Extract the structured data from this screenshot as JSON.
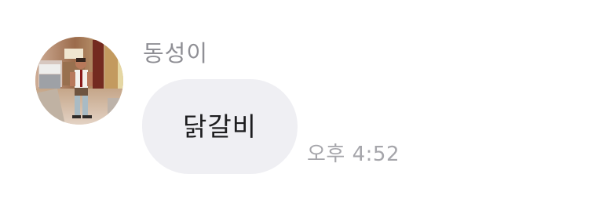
{
  "message": {
    "sender_name": "동성이",
    "avatar_icon": "profile-photo-avatar",
    "text": "닭갈비",
    "timestamp": "오후 4:52"
  },
  "colors": {
    "background": "#ffffff",
    "bubble": "#efeff3",
    "sender_name": "#8f8f95",
    "message_text": "#1d1d1f",
    "timestamp": "#a6a6ab"
  }
}
